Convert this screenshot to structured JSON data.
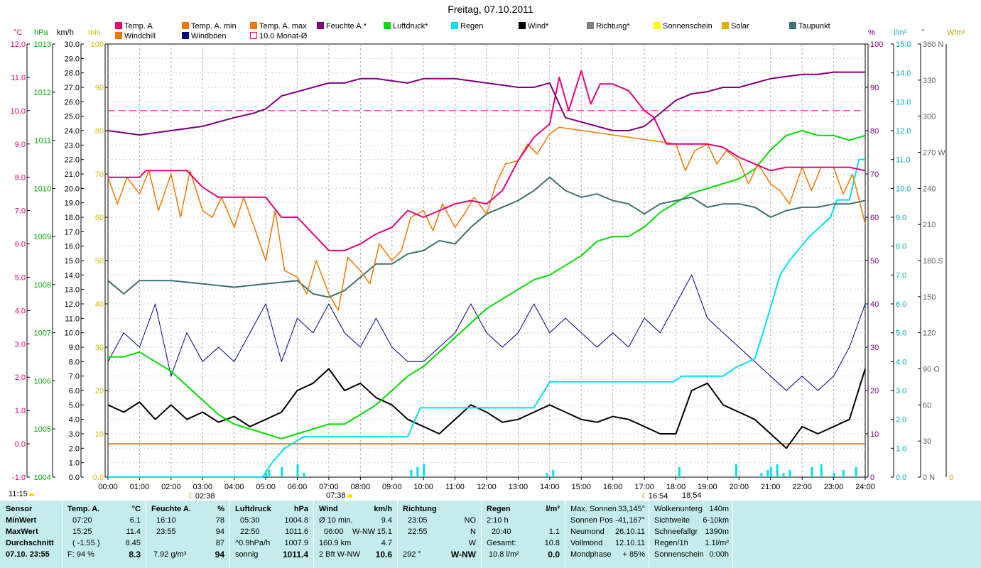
{
  "title": "Freitag, 07.10.2011",
  "legend": [
    {
      "label": "Temp. A.",
      "color": "#e8007c"
    },
    {
      "label": "Windchill",
      "color": "#f07800"
    },
    {
      "label": "Temp. A. min",
      "color": "#f07800"
    },
    {
      "label": "Windböen",
      "color": "#000080"
    },
    {
      "label": "Temp. A. max",
      "color": "#f07800"
    },
    {
      "label": "10.0 Monat-Ø",
      "color": "#e8007c"
    },
    {
      "label": "Feuchte A.*",
      "color": "#800080"
    },
    {
      "label": "Luftdruck*",
      "color": "#00dd00"
    },
    {
      "label": "Regen",
      "color": "#00e0f0"
    },
    {
      "label": "Wind*",
      "color": "#000000"
    },
    {
      "label": "Richtung*",
      "color": "#808080"
    },
    {
      "label": "Sonnenschein",
      "color": "#ffff00"
    },
    {
      "label": "Solar",
      "color": "#e0b000"
    },
    {
      "label": "Taupunkt",
      "color": "#407070"
    }
  ],
  "units": {
    "celsius": "°C",
    "hpa": "hPa",
    "kmh": "km/h",
    "min": "min",
    "percent": "%",
    "lm2": "l/m²",
    "degree": "°",
    "wm2": "W/m²"
  },
  "axis_temp": [
    "12.0",
    "11.0",
    "10.0",
    "9.0",
    "8.0",
    "7.0",
    "6.0",
    "5.0",
    "4.0",
    "3.0",
    "2.0",
    "1.0",
    "0.0",
    "-1.0"
  ],
  "axis_hpa": [
    "1013",
    "1012",
    "1011",
    "1010",
    "1009",
    "1008",
    "1007",
    "1006",
    "1005",
    "1004"
  ],
  "axis_kmh": [
    "30.0",
    "29.0",
    "28.0",
    "27.0",
    "26.0",
    "25.0",
    "24.0",
    "23.0",
    "22.0",
    "21.0",
    "20.0",
    "19.0",
    "18.0",
    "17.0",
    "16.0",
    "15.0",
    "14.0",
    "13.0",
    "12.0",
    "11.0",
    "10.0",
    "9.0",
    "8.0",
    "7.0",
    "6.0",
    "5.0",
    "4.0",
    "3.0",
    "2.0",
    "1.0",
    "0.0"
  ],
  "axis_min": [
    "100",
    "90",
    "80",
    "70",
    "60",
    "50",
    "40",
    "30",
    "20",
    "10",
    "0.0"
  ],
  "axis_pct": [
    "100",
    "90",
    "80",
    "70",
    "60",
    "50",
    "40",
    "30",
    "20",
    "10",
    "0"
  ],
  "axis_rain": [
    "15.0",
    "14.0",
    "13.0",
    "12.0",
    "11.0",
    "10.0",
    "9.0",
    "8.0",
    "7.0",
    "6.0",
    "5.0",
    "4.0",
    "3.0",
    "2.0",
    "1.0",
    "0.0"
  ],
  "axis_dir": [
    "360 N",
    "330",
    "300",
    "270 W",
    "240",
    "210",
    "180 S",
    "150",
    "120",
    "90  O",
    "60",
    "30",
    "0   N"
  ],
  "axis_solar_zero": "0",
  "time_labels": [
    "00:00",
    "01:00",
    "02:00",
    "03:00",
    "04:00",
    "05:00",
    "06:00",
    "07:00",
    "08:00",
    "09:00",
    "10:00",
    "11:00",
    "12:00",
    "13:00",
    "14:00",
    "15:00",
    "16:00",
    "17:00",
    "18:00",
    "19:00",
    "20:00",
    "21:00",
    "22:00",
    "23:00",
    "24:00"
  ],
  "sun_markers": {
    "sunrise_left": "11:15",
    "moon1": "02:38",
    "sunrise": "07:38",
    "moonset": "16:54",
    "sunset": "18:54"
  },
  "chart_data": {
    "type": "line",
    "x_label": "time",
    "x_range": [
      "00:00",
      "24:00"
    ],
    "grid": true,
    "monthly_avg_temp": 10.0,
    "series": [
      {
        "name": "Temp. A.",
        "unit": "°C",
        "x_hours": [
          0,
          0.5,
          1,
          1.2,
          2,
          2.5,
          3,
          3.5,
          4,
          4.6,
          5,
          5.5,
          6,
          6.3,
          6.7,
          7,
          7.5,
          8,
          8.5,
          9,
          9.5,
          10,
          10.5,
          11,
          11.5,
          12,
          12.5,
          13,
          13.5,
          14,
          14.3,
          14.6,
          15,
          15.3,
          15.6,
          16,
          16.5,
          17,
          17.3,
          17.7,
          18,
          18.5,
          19,
          19.5,
          20,
          20.5,
          21,
          21.5,
          22,
          22.5,
          23,
          23.5,
          24
        ],
        "values": [
          8.0,
          8.0,
          8.0,
          8.2,
          8.2,
          8.2,
          7.7,
          7.4,
          7.4,
          7.4,
          7.4,
          6.8,
          6.8,
          6.5,
          6.1,
          5.8,
          5.8,
          6.0,
          6.3,
          6.5,
          7.0,
          6.8,
          7.0,
          7.2,
          7.3,
          7.2,
          7.6,
          8.5,
          9.2,
          9.6,
          11.0,
          10.0,
          11.2,
          10.2,
          10.8,
          10.8,
          10.6,
          10.0,
          9.8,
          9.0,
          9.0,
          9.0,
          9.0,
          8.9,
          8.6,
          8.4,
          8.2,
          8.3,
          8.3,
          8.3,
          8.3,
          8.3,
          8.2
        ]
      },
      {
        "name": "Windchill",
        "unit": "°C",
        "x_hours": [
          0,
          0.3,
          0.6,
          1,
          1.3,
          1.6,
          2,
          2.3,
          2.6,
          3,
          3.3,
          3.6,
          4,
          4.3,
          4.6,
          5,
          5.3,
          5.6,
          6,
          6.3,
          6.6,
          7,
          7.3,
          7.6,
          8,
          8.3,
          8.6,
          9,
          9.3,
          9.6,
          10,
          10.3,
          10.6,
          11,
          11.3,
          11.6,
          12,
          12.3,
          12.6,
          13,
          13.3,
          13.6,
          14,
          14.3,
          18,
          18.3,
          18.6,
          19,
          19.3,
          19.6,
          20,
          20.3,
          20.6,
          21,
          21.3,
          21.6,
          22,
          22.3,
          22.6,
          23,
          23.3,
          23.6,
          24
        ],
        "values": [
          8.0,
          7.2,
          8.0,
          7.5,
          8.2,
          7.0,
          8.1,
          6.8,
          8.2,
          7.0,
          6.8,
          7.4,
          6.5,
          7.4,
          6.6,
          5.5,
          7.0,
          5.2,
          5.0,
          4.5,
          5.5,
          4.5,
          4.0,
          5.6,
          5.2,
          4.8,
          6.0,
          5.5,
          5.8,
          6.8,
          7.0,
          6.4,
          7.2,
          6.5,
          6.9,
          7.4,
          6.9,
          7.8,
          8.4,
          8.5,
          9.0,
          8.7,
          9.3,
          9.5,
          9.0,
          8.2,
          8.8,
          9.0,
          8.4,
          8.8,
          8.5,
          7.8,
          8.4,
          7.8,
          7.6,
          7.2,
          8.3,
          7.6,
          8.3,
          8.3,
          7.5,
          8.1,
          6.6
        ]
      },
      {
        "name": "Feuchte A.*",
        "unit": "%",
        "x_hours": [
          0,
          0.5,
          1,
          2,
          3,
          4,
          4.6,
          5,
          5.5,
          6,
          6.5,
          7,
          7.5,
          8,
          8.5,
          9,
          9.5,
          10,
          10.5,
          11,
          11.5,
          12,
          12.5,
          13,
          13.5,
          14,
          14.5,
          15,
          15.5,
          16,
          16.5,
          17,
          17.5,
          18,
          18.5,
          19,
          19.5,
          20,
          20.5,
          21,
          21.5,
          22,
          22.5,
          23,
          23.5,
          24
        ],
        "values": [
          80,
          79.5,
          79,
          80,
          81,
          83,
          84,
          85,
          88,
          89,
          90,
          91,
          91,
          92,
          92,
          91.5,
          91,
          92,
          92,
          92,
          91.5,
          91,
          90.5,
          90,
          90,
          91,
          83,
          82,
          81,
          80,
          80,
          81,
          84,
          87,
          88.5,
          89,
          90,
          90,
          91,
          92,
          92.5,
          93,
          93,
          93.5,
          93.5,
          93.5
        ]
      },
      {
        "name": "Luftdruck*",
        "unit": "hPa",
        "x_hours": [
          0,
          0.5,
          1,
          1.5,
          2,
          2.5,
          3,
          3.5,
          4,
          4.5,
          5,
          5.5,
          6,
          6.5,
          7,
          7.5,
          8,
          8.5,
          9,
          9.5,
          10,
          10.5,
          11,
          11.5,
          12,
          12.5,
          13,
          13.5,
          14,
          14.5,
          15,
          15.5,
          16,
          16.5,
          17,
          17.5,
          18,
          18.5,
          19,
          19.5,
          20,
          20.5,
          21,
          21.5,
          22,
          22.5,
          23,
          23.5,
          24
        ],
        "values": [
          1006.5,
          1006.5,
          1006.6,
          1006.4,
          1006.2,
          1005.9,
          1005.6,
          1005.3,
          1005.1,
          1005.0,
          1004.9,
          1004.8,
          1004.9,
          1005.0,
          1005.1,
          1005.1,
          1005.3,
          1005.5,
          1005.8,
          1006.1,
          1006.3,
          1006.6,
          1006.9,
          1007.2,
          1007.5,
          1007.7,
          1007.9,
          1008.1,
          1008.2,
          1008.4,
          1008.6,
          1008.9,
          1009.0,
          1009.0,
          1009.2,
          1009.5,
          1009.7,
          1009.9,
          1010.0,
          1010.1,
          1010.2,
          1010.4,
          1010.8,
          1011.1,
          1011.2,
          1011.1,
          1011.1,
          1011.0,
          1011.1
        ]
      },
      {
        "name": "Regen",
        "unit": "l/m²",
        "x_hours": [
          0,
          4.9,
          5.2,
          5.6,
          6.2,
          9.5,
          9.9,
          10.5,
          13.5,
          14.0,
          16,
          17,
          17.9,
          18.2,
          19.5,
          19.9,
          20.5,
          20.9,
          21.3,
          21.6,
          22.2,
          22.5,
          22.9,
          23.1,
          23.5,
          23.8,
          24
        ],
        "values": [
          0,
          0,
          0.5,
          1.0,
          1.4,
          1.4,
          2.4,
          2.4,
          2.4,
          3.3,
          3.3,
          3.3,
          3.3,
          3.5,
          3.5,
          3.8,
          4.1,
          5.5,
          7.0,
          7.5,
          8.3,
          8.6,
          9.0,
          9.6,
          9.6,
          11.0,
          11.0
        ]
      },
      {
        "name": "Taupunkt",
        "unit": "°C",
        "x_hours": [
          0,
          0.5,
          1,
          2,
          3,
          4,
          5,
          6,
          6.5,
          7,
          7.5,
          8,
          8.5,
          9,
          9.5,
          10,
          10.5,
          11,
          11.5,
          12,
          12.5,
          13,
          13.5,
          14,
          14.5,
          15,
          15.5,
          16,
          16.5,
          17,
          17.5,
          18,
          18.5,
          19,
          19.5,
          20,
          20.5,
          21,
          21.5,
          22,
          22.5,
          23,
          23.5,
          24
        ],
        "values": [
          4.9,
          4.5,
          4.9,
          4.9,
          4.8,
          4.7,
          4.8,
          4.9,
          4.5,
          4.4,
          4.6,
          5.0,
          5.4,
          5.4,
          5.7,
          5.8,
          6.1,
          6.0,
          6.5,
          6.9,
          7.1,
          7.3,
          7.6,
          8.0,
          7.6,
          7.4,
          7.5,
          7.3,
          7.2,
          6.9,
          7.2,
          7.3,
          7.4,
          7.1,
          7.2,
          7.2,
          7.1,
          6.8,
          7.0,
          7.1,
          7.1,
          7.2,
          7.2,
          7.3
        ]
      },
      {
        "name": "Wind*",
        "unit": "km/h",
        "x_hours": [
          0,
          0.5,
          1,
          1.5,
          2,
          2.5,
          3,
          3.5,
          4,
          4.5,
          5,
          5.5,
          6,
          6.5,
          7,
          7.5,
          8,
          8.5,
          9,
          9.5,
          10,
          10.5,
          11,
          11.5,
          12,
          12.5,
          13,
          13.5,
          14,
          14.5,
          15,
          15.5,
          16,
          16.5,
          17,
          17.5,
          18,
          18.5,
          19,
          19.5,
          20,
          20.5,
          21,
          21.5,
          22,
          22.5,
          23,
          23.5,
          24
        ],
        "values": [
          5.0,
          4.5,
          5.2,
          4.0,
          5.0,
          4.0,
          4.5,
          3.8,
          4.2,
          3.5,
          4.0,
          4.5,
          6.0,
          6.5,
          7.5,
          6.0,
          6.5,
          5.5,
          5.0,
          4.0,
          3.5,
          3.0,
          4.0,
          5.0,
          4.5,
          3.8,
          4.0,
          4.5,
          5.0,
          4.5,
          4.0,
          3.8,
          4.2,
          4.0,
          3.5,
          3.0,
          3.0,
          6.0,
          6.5,
          5.0,
          4.5,
          4.0,
          3.0,
          2.0,
          3.5,
          3.0,
          3.5,
          4.0,
          7.5
        ]
      },
      {
        "name": "Windböen",
        "unit": "km/h",
        "x_hours": [
          0,
          0.5,
          1,
          1.5,
          2,
          2.5,
          3,
          3.5,
          4,
          4.5,
          5,
          5.5,
          6,
          6.5,
          7,
          7.5,
          8,
          8.5,
          9,
          9.5,
          10,
          10.5,
          11,
          11.5,
          12,
          12.5,
          13,
          13.5,
          14,
          14.5,
          15,
          15.5,
          16,
          16.5,
          17,
          17.5,
          18,
          18.5,
          19,
          19.5,
          20,
          20.5,
          21,
          21.5,
          22,
          22.5,
          23,
          23.5,
          24
        ],
        "values": [
          8.0,
          10.0,
          9.0,
          12.0,
          7.0,
          10.0,
          8.0,
          9.0,
          8.0,
          10.0,
          12.0,
          8.0,
          11.0,
          10.0,
          12.0,
          10.0,
          9.0,
          11.0,
          9.0,
          8.0,
          8.0,
          9.0,
          10.0,
          12.0,
          10.0,
          9.0,
          10.0,
          12.0,
          10.0,
          11.0,
          10.0,
          9.0,
          10.0,
          9.0,
          11.0,
          10.0,
          12.0,
          14.0,
          11.0,
          10.0,
          9.0,
          8.0,
          7.0,
          6.0,
          7.0,
          6.0,
          7.0,
          9.0,
          12.0
        ]
      }
    ]
  },
  "panel": {
    "col1": {
      "header": "Sensor",
      "rows": [
        "MinWert",
        "MaxWert",
        "Durchschnitt",
        "07.10. 23:55"
      ]
    },
    "col2": {
      "header": "Temp. A.",
      "unit": "°C",
      "rows": [
        [
          "07:20",
          "6.1"
        ],
        [
          "15:25",
          "11.4"
        ],
        [
          "( -1.55 )",
          "8.45"
        ],
        [
          "F: 94 %",
          "8.3"
        ]
      ]
    },
    "col3": {
      "header": "Feuchte A.",
      "unit": "%",
      "rows": [
        [
          "16:10",
          "78"
        ],
        [
          "23:55",
          "94"
        ],
        [
          "",
          "87"
        ],
        [
          "7.92 g/m³",
          "94"
        ]
      ]
    },
    "col4": {
      "header": "Luftdruck",
      "unit": "hPa",
      "rows": [
        [
          "05:30",
          "1004.8"
        ],
        [
          "22:50",
          "1011.6"
        ],
        [
          "^0.9hPa/h",
          "1007.9"
        ],
        [
          "sonnig",
          "1011.4"
        ]
      ]
    },
    "col5": {
      "header": "Wind",
      "unit": "km/h",
      "rows": [
        [
          "Ø 10 min.",
          "",
          "9.4"
        ],
        [
          "06:00",
          "W-NW",
          "15.1"
        ],
        [
          "160.9 km",
          "",
          "4.7"
        ],
        [
          "2 Bft W-NW",
          "",
          "10.6"
        ]
      ]
    },
    "col6": {
      "header": "Richtung",
      "rows": [
        [
          "23:05",
          "NO"
        ],
        [
          "22:55",
          "N"
        ],
        [
          "",
          "W"
        ],
        [
          "292 °",
          "W-NW"
        ]
      ]
    },
    "col7": {
      "header": "Regen",
      "unit": "l/m²",
      "rows": [
        [
          "2:10 h",
          ""
        ],
        [
          "20:40",
          "1.1"
        ],
        [
          "Gesamt:",
          "10.8"
        ],
        [
          "10.8 l/m²",
          "0.0"
        ]
      ]
    },
    "col8": {
      "rows": [
        [
          "Max. Sonnen",
          "33,145°"
        ],
        [
          "Sonnen Pos",
          "-41,167°"
        ],
        [
          "Neumond",
          "26.10.11"
        ],
        [
          "Vollmond",
          "12.10.11"
        ],
        [
          "Mondphase",
          "+ 85%"
        ]
      ]
    },
    "col9": {
      "rows": [
        [
          "Wolkenunterg",
          "140m"
        ],
        [
          "Sichtweite",
          "6-10km"
        ],
        [
          "Schneefallgr",
          "1390m"
        ],
        [
          "Regen/1h",
          "1.1l/m²"
        ],
        [
          "Sonnenschein",
          "0:00h"
        ]
      ]
    }
  }
}
